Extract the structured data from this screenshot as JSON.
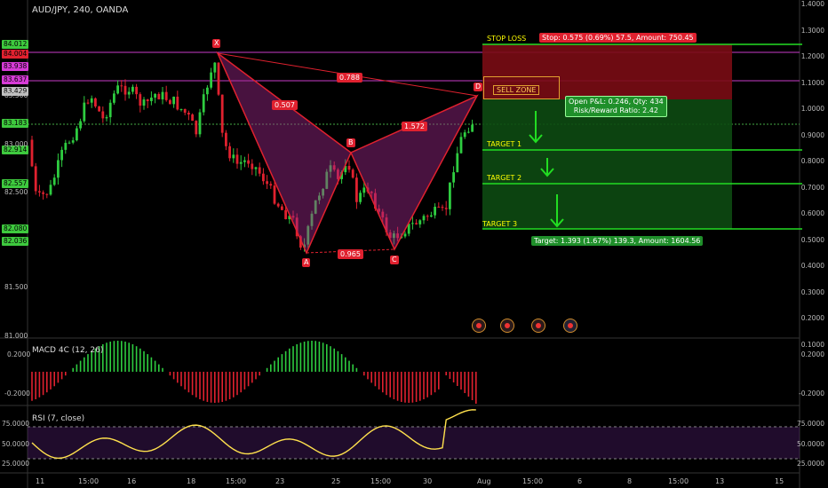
{
  "header": {
    "symbol_title": "AUD/JPY, 240, OANDA"
  },
  "pattern": {
    "points": [
      "X",
      "A",
      "B",
      "C",
      "D"
    ],
    "ratios": {
      "xb": "0.507",
      "xd": "0.788",
      "bd": "1.572",
      "ac": "0.965"
    }
  },
  "levels": {
    "stop_loss_label": "STOP LOSS",
    "stop_info": "Stop: 0.575 (0.69%) 57.5, Amount: 750.45",
    "sell_zone": "SELL  ZONE",
    "pnl_line1": "Open P&L: 0.246, Qty: 434",
    "pnl_line2": "Risk/Reward Ratio: 2.42",
    "target1": "TARGET 1",
    "target2": "TARGET 2",
    "target3": "TARGET 3",
    "target_info": "Target: 1.393 (1.67%) 139.3, Amount: 1604.56"
  },
  "price_axis_left": {
    "ticks": [
      "83.500",
      "83.000",
      "82.500",
      "81.500",
      "81.000"
    ],
    "tags": [
      {
        "text": "84.012",
        "color": "#3ec93e"
      },
      {
        "text": "84.004",
        "color": "#e0212f"
      },
      {
        "text": "83.938",
        "color": "#d63bd6"
      },
      {
        "text": "83.637",
        "color": "#d63bd6"
      },
      {
        "text": "83.429",
        "color": "#c0c0c0"
      },
      {
        "text": "83.183",
        "color": "#3ec93e"
      },
      {
        "text": "82.914",
        "color": "#3ec93e"
      },
      {
        "text": "82.557",
        "color": "#3ec93e"
      },
      {
        "text": "82.080",
        "color": "#3ec93e"
      },
      {
        "text": "82.036",
        "color": "#3ec93e"
      }
    ]
  },
  "price_axis_right": {
    "ticks": [
      "1.4000",
      "1.3000",
      "1.2000",
      "1.1000",
      "1.0000",
      "0.9000",
      "0.8000",
      "0.7000",
      "0.6000",
      "0.5000",
      "0.4000",
      "0.3000",
      "0.2000",
      "0.1000"
    ]
  },
  "macd": {
    "title": "MACD 4C (12, 26)",
    "ticks_left": [
      "0.2000",
      "-0.2000"
    ],
    "ticks_right": [
      "0.2000",
      "-0.2000"
    ]
  },
  "rsi": {
    "title": "RSI (7, close)",
    "ticks_left": [
      "75.0000",
      "50.0000",
      "25.0000"
    ],
    "ticks_right": [
      "75.0000",
      "50.0000",
      "25.0000"
    ]
  },
  "time_axis": [
    "11",
    "15:00",
    "16",
    "18",
    "15:00",
    "23",
    "25",
    "15:00",
    "30",
    "Aug",
    "15:00",
    "6",
    "8",
    "15:00",
    "13",
    "15"
  ],
  "colors": {
    "bull": "#2ecc40",
    "bear": "#e0212f",
    "pattern": "#e0212f",
    "target": "#22dd22"
  }
}
